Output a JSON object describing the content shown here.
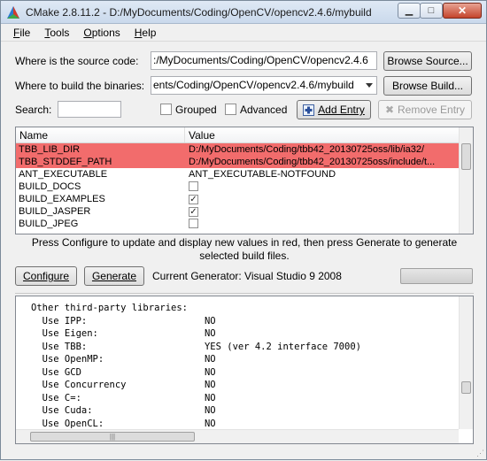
{
  "window": {
    "title": "CMake 2.8.11.2 - D:/MyDocuments/Coding/OpenCV/opencv2.4.6/mybuild"
  },
  "menu": [
    {
      "first": "F",
      "rest": "ile"
    },
    {
      "first": "T",
      "rest": "ools"
    },
    {
      "first": "O",
      "rest": "ptions"
    },
    {
      "first": "H",
      "rest": "elp"
    }
  ],
  "source": {
    "label": "Where is the source code:",
    "value": ":/MyDocuments/Coding/OpenCV/opencv2.4.6",
    "browse": "Browse Source..."
  },
  "build": {
    "label": "Where to build the binaries:",
    "value": "ents/Coding/OpenCV/opencv2.4.6/mybuild",
    "browse": "Browse Build..."
  },
  "search": {
    "label": "Search:",
    "value": "",
    "grouped": "Grouped",
    "advanced": "Advanced",
    "add_entry": "Add Entry",
    "remove_entry": "Remove Entry"
  },
  "table": {
    "headers": {
      "name": "Name",
      "value": "Value"
    },
    "rows": [
      {
        "name": "TBB_LIB_DIR",
        "value": "D:/MyDocuments/Coding/tbb42_20130725oss/lib/ia32/",
        "type": "text",
        "red": true
      },
      {
        "name": "TBB_STDDEF_PATH",
        "value": "D:/MyDocuments/Coding/tbb42_20130725oss/include/t...",
        "type": "text",
        "red": true
      },
      {
        "name": "ANT_EXECUTABLE",
        "value": "ANT_EXECUTABLE-NOTFOUND",
        "type": "text",
        "red": false
      },
      {
        "name": "BUILD_DOCS",
        "value": "",
        "type": "check",
        "checked": false,
        "red": false
      },
      {
        "name": "BUILD_EXAMPLES",
        "value": "",
        "type": "check",
        "checked": true,
        "red": false
      },
      {
        "name": "BUILD_JASPER",
        "value": "",
        "type": "check",
        "checked": true,
        "red": false
      },
      {
        "name": "BUILD_JPEG",
        "value": "",
        "type": "check",
        "checked": false,
        "red": false
      }
    ]
  },
  "hint": "Press Configure to update and display new values in red, then press Generate to generate selected build files.",
  "actions": {
    "configure": "Configure",
    "generate": "Generate",
    "generator": "Current Generator: Visual Studio 9 2008"
  },
  "output": {
    "lines": [
      "Other third-party libraries:",
      "  Use IPP:                     NO",
      "  Use Eigen:                   NO",
      "  Use TBB:                     YES (ver 4.2 interface 7000)",
      "  Use OpenMP:                  NO",
      "  Use GCD                      NO",
      "  Use Concurrency              NO",
      "  Use C=:                      NO",
      "  Use Cuda:                    NO",
      "  Use OpenCL:                  NO"
    ]
  },
  "colors": {
    "changed_row": "#f26c6c"
  }
}
